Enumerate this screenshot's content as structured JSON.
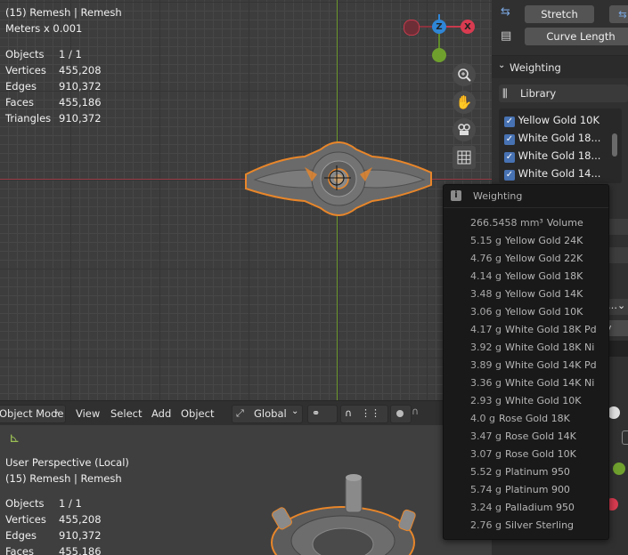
{
  "top_viewport": {
    "header_line": "(15) Remesh | Remesh",
    "units": "Meters x 0.001",
    "stats": [
      {
        "label": "Objects",
        "value": "1 / 1"
      },
      {
        "label": "Vertices",
        "value": "455,208"
      },
      {
        "label": "Edges",
        "value": "910,372"
      },
      {
        "label": "Faces",
        "value": "455,186"
      },
      {
        "label": "Triangles",
        "value": "910,372"
      }
    ],
    "gizmo": {
      "x": "X",
      "z": "Z",
      "colors": {
        "x": "#d83b50",
        "y": "#6fa02e",
        "z": "#2f86d6"
      }
    }
  },
  "header_bar": {
    "mode": "Object Mode",
    "menus": [
      "View",
      "Select",
      "Add",
      "Object"
    ],
    "orientation": "Global"
  },
  "bottom_viewport": {
    "perspective": "User Perspective (Local)",
    "header_line": "(15) Remesh | Remesh",
    "stats": [
      {
        "label": "Objects",
        "value": "1 / 1"
      },
      {
        "label": "Vertices",
        "value": "455,208"
      },
      {
        "label": "Edges",
        "value": "910,372"
      },
      {
        "label": "Faces",
        "value": "455,186"
      }
    ]
  },
  "panel": {
    "stretch_label": "Stretch",
    "curve_length_label": "Curve Length",
    "weighting_title": "Weighting",
    "library_label": "Library",
    "library_items": [
      {
        "label": "Yellow Gold 10K",
        "checked": true
      },
      {
        "label": "White Gold 18...",
        "checked": true
      },
      {
        "label": "White Gold 18...",
        "checked": true
      },
      {
        "label": "White Gold 14...",
        "checked": true
      }
    ]
  },
  "popup": {
    "title": "Weighting",
    "rows": [
      {
        "amount": "266.5458 mm³",
        "label": "Volume"
      },
      {
        "amount": "5.15 g",
        "label": "Yellow Gold 24K"
      },
      {
        "amount": "4.76 g",
        "label": "Yellow Gold 22K"
      },
      {
        "amount": "4.14 g",
        "label": "Yellow Gold 18K"
      },
      {
        "amount": "3.48 g",
        "label": "Yellow Gold 14K"
      },
      {
        "amount": "3.06 g",
        "label": "Yellow Gold 10K"
      },
      {
        "amount": "4.17 g",
        "label": "White Gold 18K Pd"
      },
      {
        "amount": "3.92 g",
        "label": "White Gold 18K Ni"
      },
      {
        "amount": "3.89 g",
        "label": "White Gold 14K Pd"
      },
      {
        "amount": "3.36 g",
        "label": "White Gold 14K Ni"
      },
      {
        "amount": "2.93 g",
        "label": "White Gold 10K"
      },
      {
        "amount": "4.0 g",
        "label": "Rose Gold 18K"
      },
      {
        "amount": "3.47 g",
        "label": "Rose Gold 14K"
      },
      {
        "amount": "3.07 g",
        "label": "Rose Gold 10K"
      },
      {
        "amount": "5.52 g",
        "label": "Platinum 950"
      },
      {
        "amount": "5.74 g",
        "label": "Platinum 900"
      },
      {
        "amount": "3.24 g",
        "label": "Palladium 950"
      },
      {
        "amount": "2.76 g",
        "label": "Silver Sterling"
      }
    ]
  }
}
